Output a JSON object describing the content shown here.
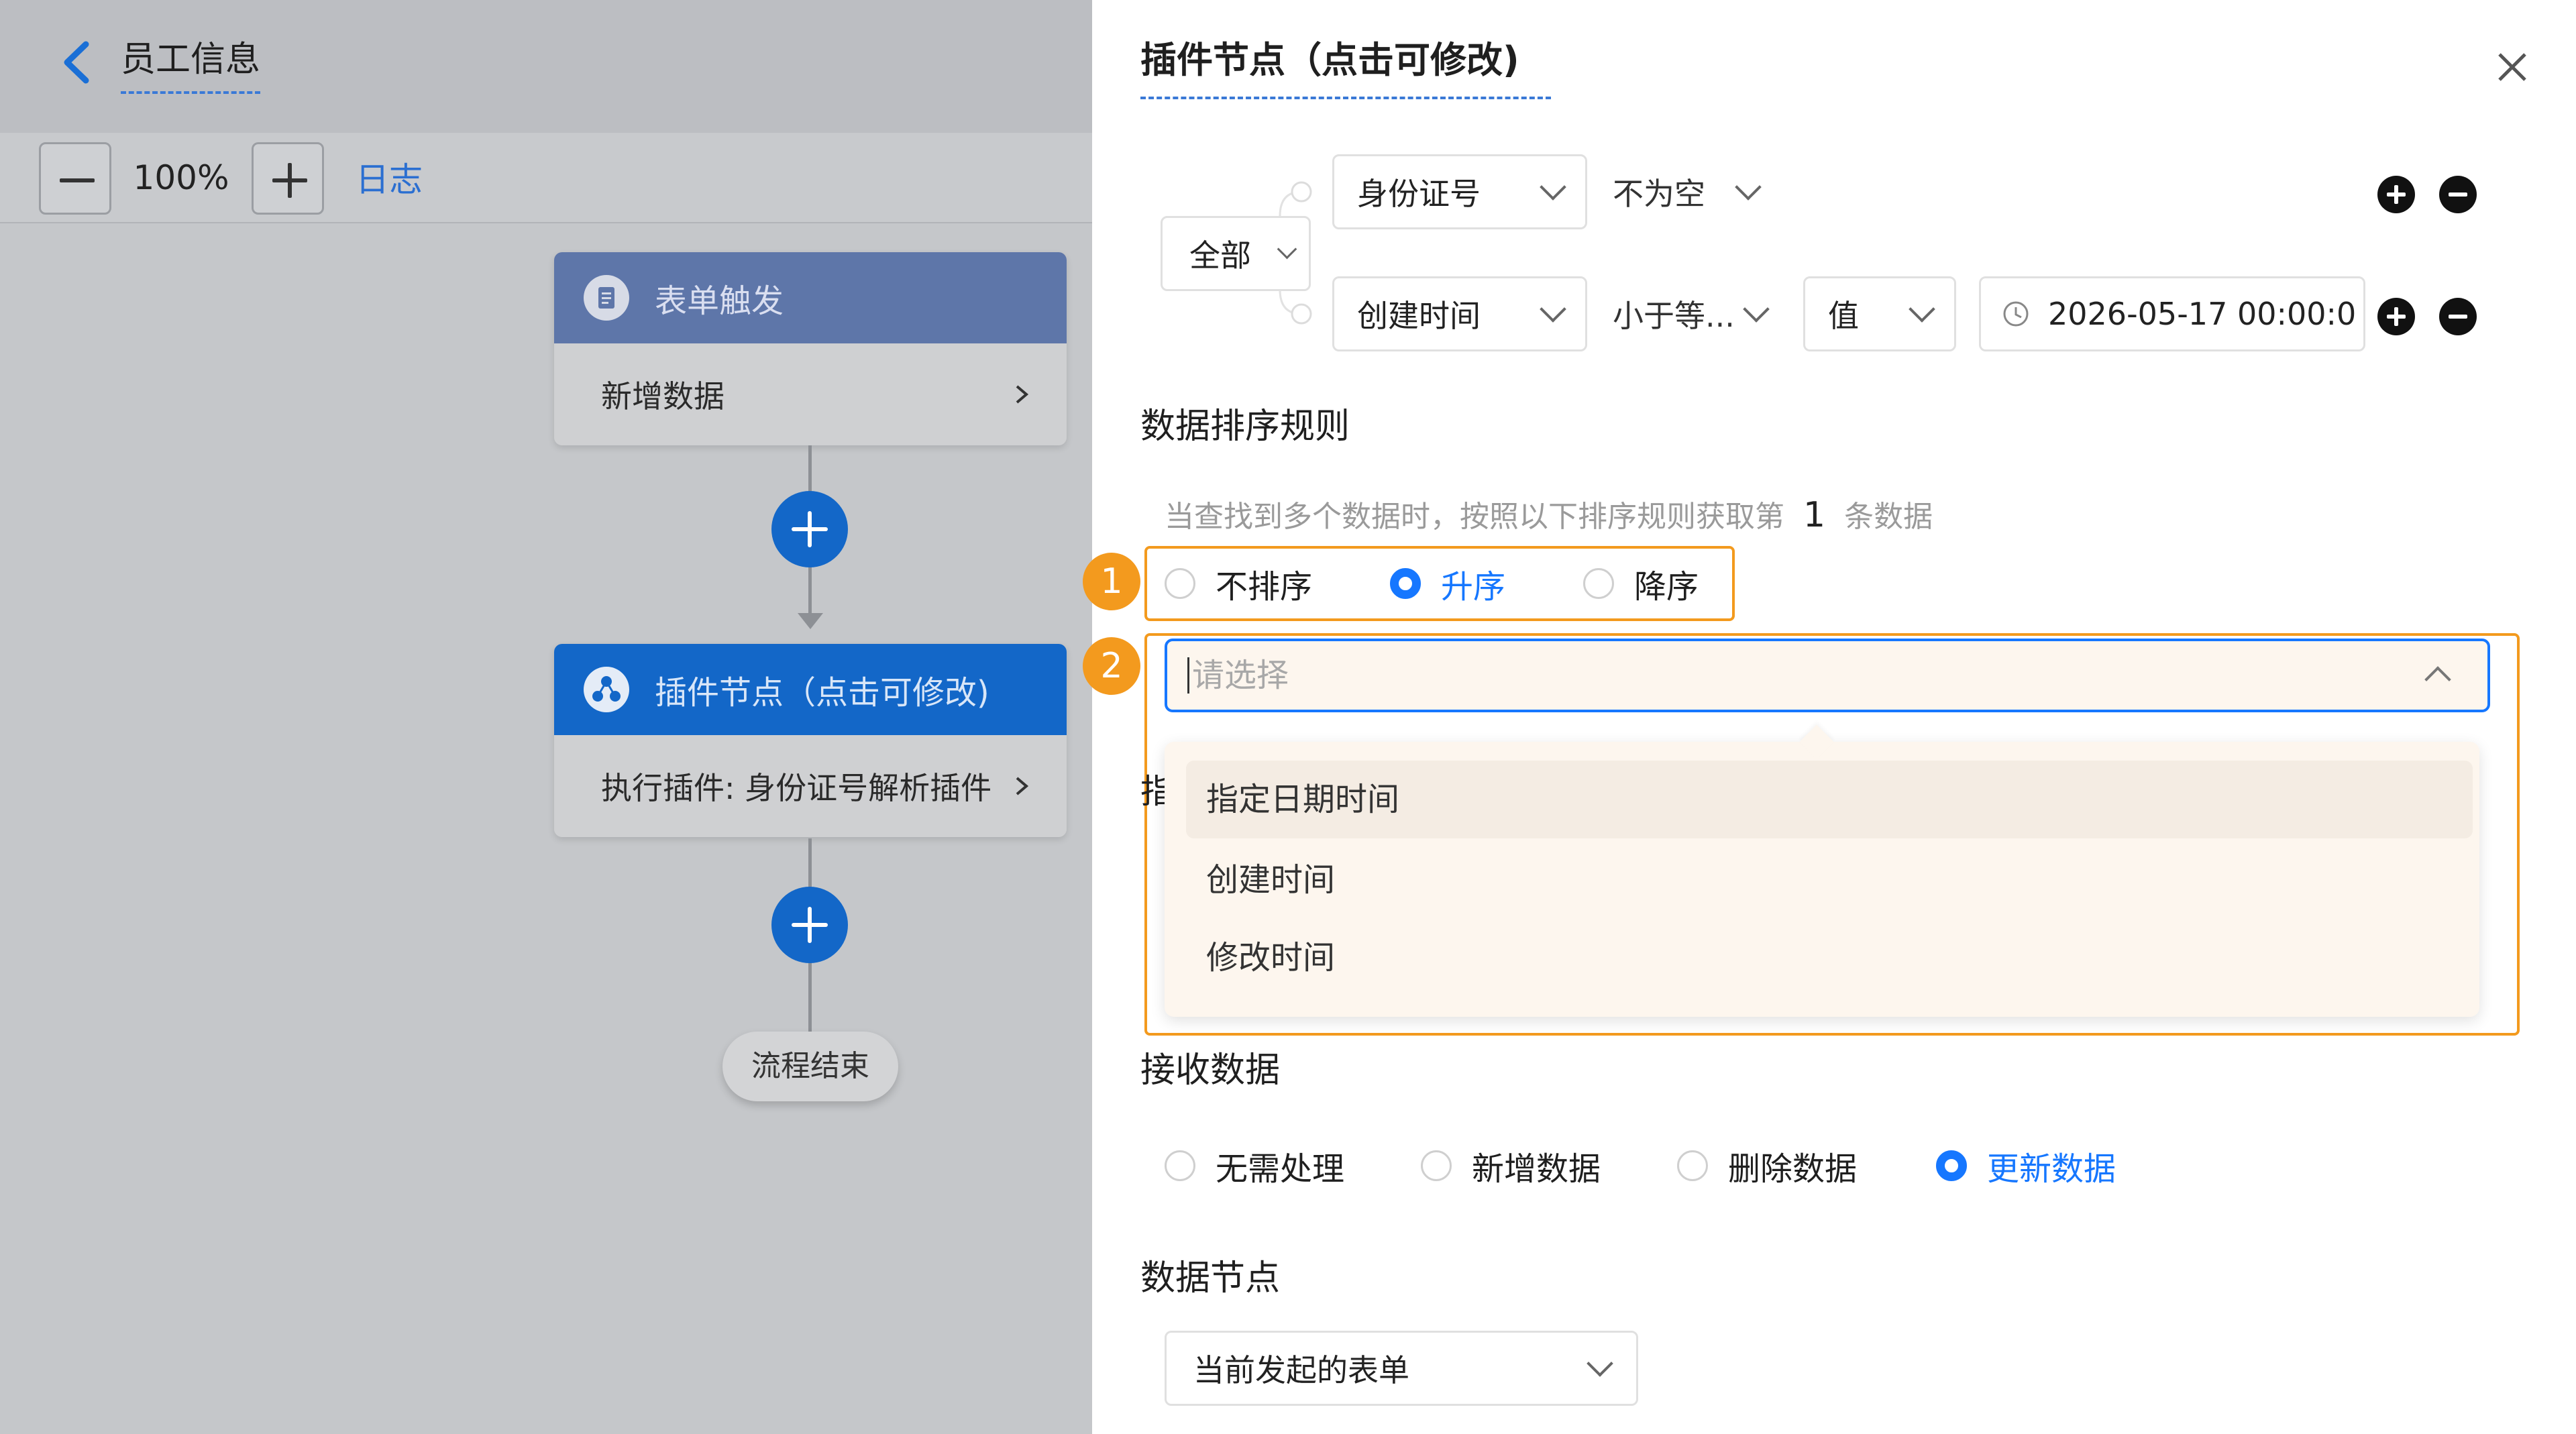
{
  "app": {
    "title": "员工信息",
    "zoom": "100%",
    "log_label": "日志"
  },
  "flow": {
    "trigger_card": {
      "title": "表单触发",
      "body": "新增数据"
    },
    "plugin_card": {
      "title": "插件节点（点击可修改)",
      "body": "执行插件: 身份证号解析插件"
    },
    "end_label": "流程结束"
  },
  "panel": {
    "title": "插件节点（点击可修改)",
    "filter": {
      "group_operator": "全部",
      "rows": [
        {
          "field": "身份证号",
          "condition": "不为空"
        },
        {
          "field": "创建时间",
          "condition": "小于等...",
          "value_type": "值",
          "value": "2026-05-17 00:00:0"
        }
      ]
    },
    "sort": {
      "section_title": "数据排序规则",
      "hint_prefix": "当查找到多个数据时，按照以下排序规则获取第",
      "hint_number": "1",
      "hint_suffix": "条数据",
      "options": [
        "不排序",
        "升序",
        "降序"
      ],
      "selected": "升序",
      "field_placeholder": "请选择",
      "dropdown_options": [
        "指定日期时间",
        "创建时间",
        "修改时间"
      ],
      "hidden_label_fragment": "指"
    },
    "receive": {
      "section_title": "接收数据",
      "options": [
        "无需处理",
        "新增数据",
        "删除数据",
        "更新数据"
      ],
      "selected": "更新数据"
    },
    "data_node": {
      "section_title": "数据节点",
      "value": "当前发起的表单"
    },
    "annotations": [
      "1",
      "2"
    ]
  },
  "colors": {
    "accent": "#1677ff",
    "annotation": "#f39a1e",
    "trigger_header": "#5e76a9",
    "plugin_header": "#1367c8",
    "dropdown_bg": "#fdf6ee"
  }
}
